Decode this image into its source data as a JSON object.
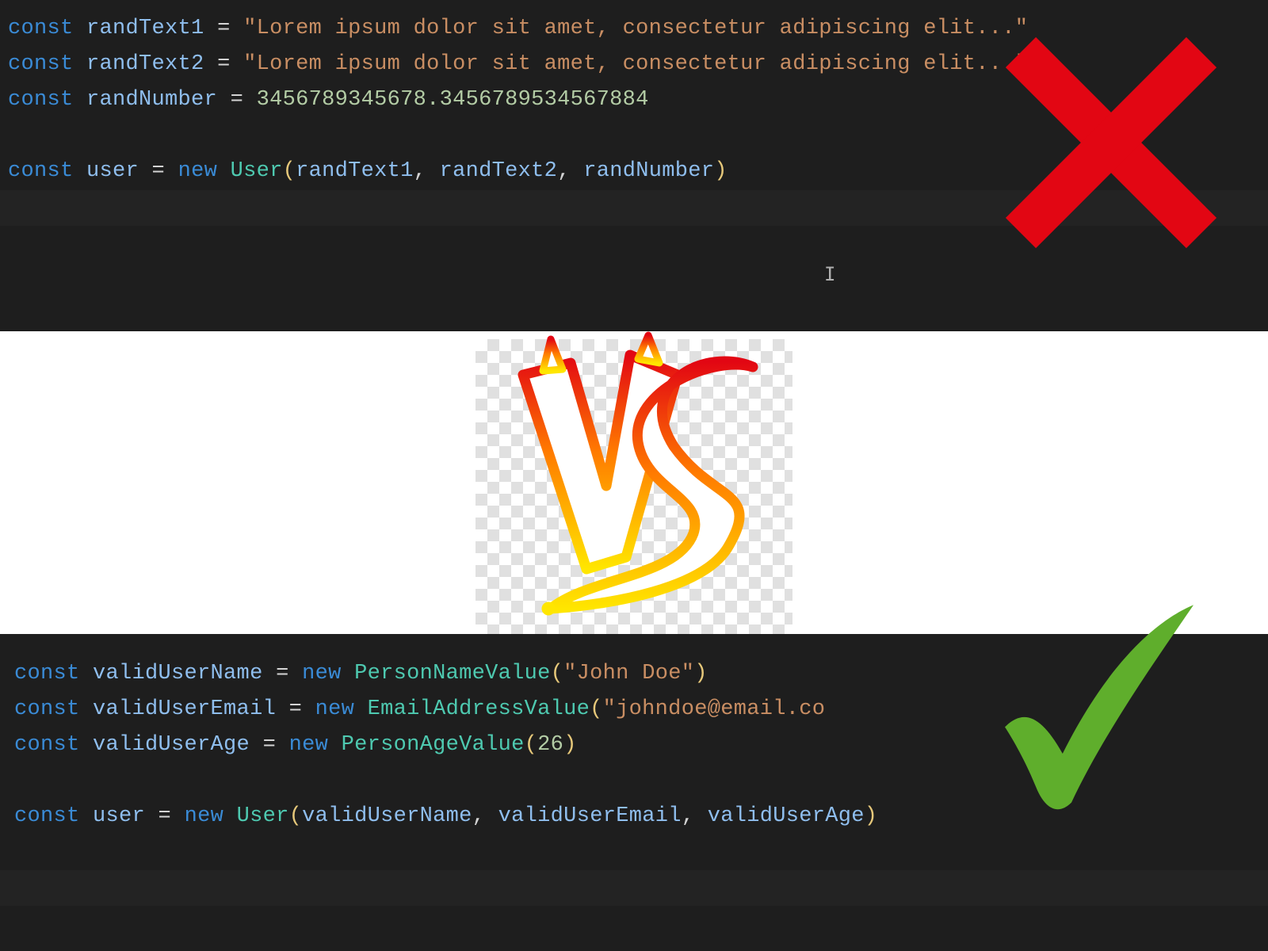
{
  "top_code": {
    "line1": {
      "kw": "const",
      "name": "randText1",
      "assign": " = ",
      "value": "\"Lorem ipsum dolor sit amet, consectetur adipiscing elit...\""
    },
    "line2": {
      "kw": "const",
      "name": "randText2",
      "assign": " = ",
      "value": "\"Lorem ipsum dolor sit amet, consectetur adipiscing elit...\""
    },
    "line3": {
      "kw": "const",
      "name": "randNumber",
      "assign": " = ",
      "value": "3456789345678.3456789534567884"
    },
    "line5": {
      "kw": "const",
      "name": "user",
      "assign": " = ",
      "new": "new ",
      "type": "User",
      "lparen": "(",
      "arg1": "randText1",
      "c1": ", ",
      "arg2": "randText2",
      "c2": ", ",
      "arg3": "randNumber",
      "rparen": ")"
    }
  },
  "bottom_code": {
    "line1": {
      "kw": "const",
      "name": "validUserName",
      "assign": " = ",
      "new": "new ",
      "type": "PersonNameValue",
      "lparen": "(",
      "arg1": "\"John Doe\"",
      "rparen": ")"
    },
    "line2": {
      "kw": "const",
      "name": "validUserEmail",
      "assign": " = ",
      "new": "new ",
      "type": "EmailAddressValue",
      "lparen": "(",
      "arg1": "\"johndoe@email.co",
      "rparen": ""
    },
    "line3": {
      "kw": "const",
      "name": "validUserAge",
      "assign": " = ",
      "new": "new ",
      "type": "PersonAgeValue",
      "lparen": "(",
      "arg1": "26",
      "rparen": ")"
    },
    "line5": {
      "kw": "const",
      "name": "user",
      "assign": " = ",
      "new": "new ",
      "type": "User",
      "lparen": "(",
      "arg1": "validUserName",
      "c1": ", ",
      "arg2": "validUserEmail",
      "c2": ", ",
      "arg3": "validUserAge",
      "rparen": ")"
    }
  },
  "overlays": {
    "cross": "cross-icon",
    "check": "check-icon",
    "vs": "VS",
    "caret": "I"
  },
  "colors": {
    "editor_bg": "#1e1e1e",
    "keyword": "#3a8bd6",
    "identifier": "#8fbeee",
    "string": "#c98e63",
    "number": "#b3cca5",
    "type": "#4ec9b0",
    "paren": "#e6c87a",
    "cross": "#e20613",
    "check": "#5fae2c"
  }
}
